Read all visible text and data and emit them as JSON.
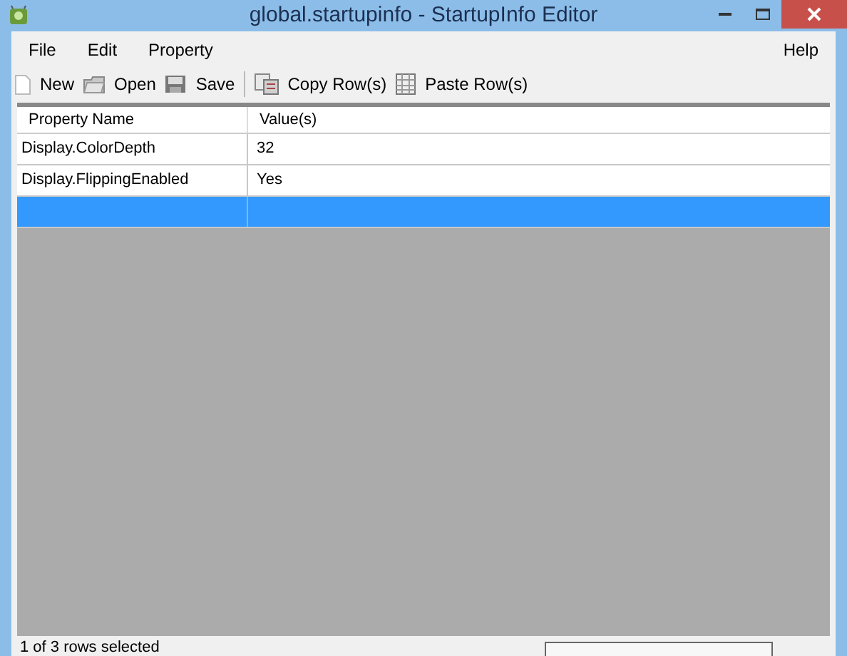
{
  "window": {
    "title": "global.startupinfo - StartupInfo Editor"
  },
  "menu": [
    {
      "label": "File"
    },
    {
      "label": "Edit"
    },
    {
      "label": "Property"
    }
  ],
  "menu_right": [
    {
      "label": "Help"
    }
  ],
  "toolbar": [
    {
      "kind": "page",
      "label": "New"
    },
    {
      "kind": "folder",
      "label": "Open"
    },
    {
      "kind": "disk",
      "label": "Save"
    },
    {
      "kind": "separator"
    },
    {
      "kind": "copy",
      "label": "Copy Row(s)"
    },
    {
      "kind": "grid",
      "label": "Paste Row(s)"
    }
  ],
  "table": {
    "columns": [
      "Property Name",
      "Value(s)"
    ],
    "rows": [
      {
        "cells": [
          "Display.ColorDepth",
          "32"
        ],
        "selected": false
      },
      {
        "cells": [
          "Display.FlippingEnabled",
          "Yes"
        ],
        "selected": false
      },
      {
        "selected": true
      }
    ]
  },
  "status_bar": {
    "text": "1 of 3 rows selected"
  }
}
